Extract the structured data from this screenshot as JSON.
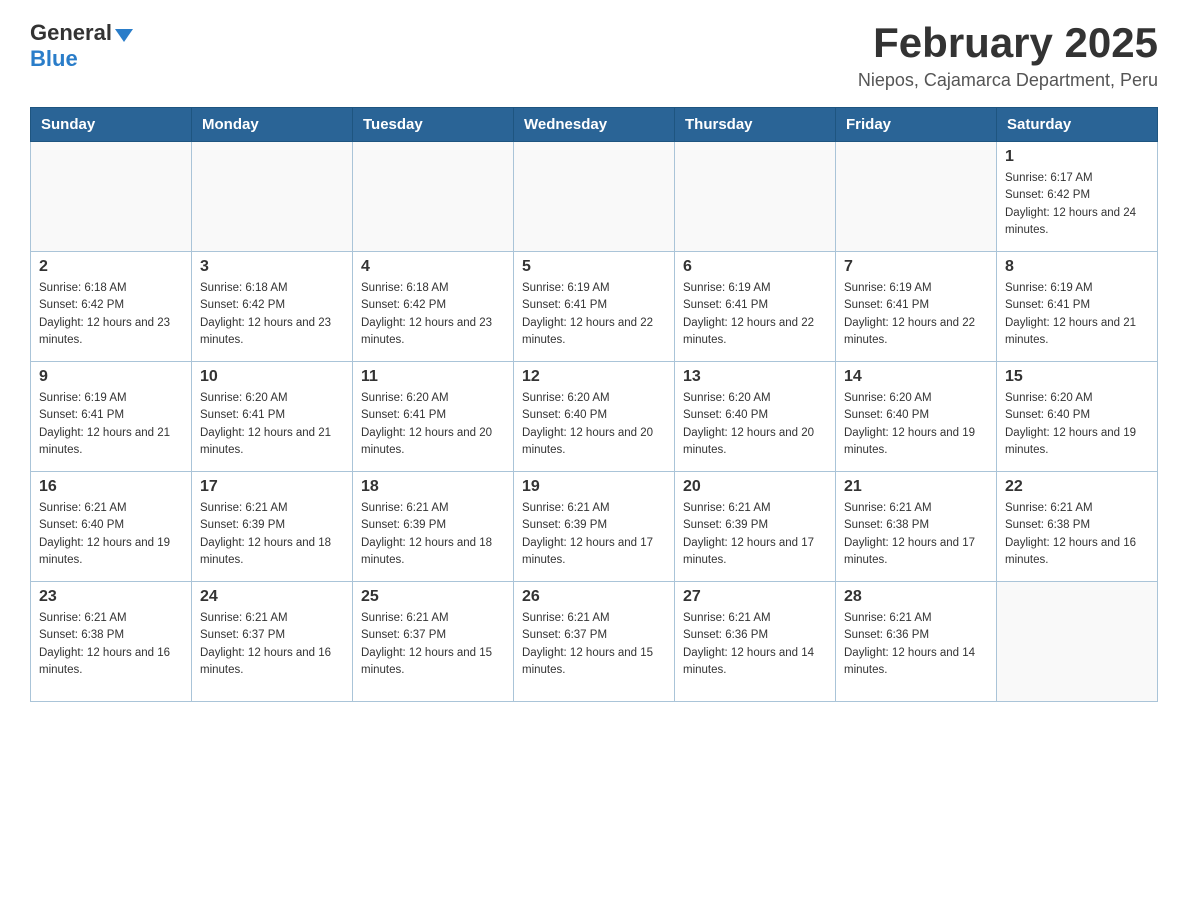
{
  "header": {
    "logo_general": "General",
    "logo_blue": "Blue",
    "month_title": "February 2025",
    "location": "Niepos, Cajamarca Department, Peru"
  },
  "weekdays": [
    "Sunday",
    "Monday",
    "Tuesday",
    "Wednesday",
    "Thursday",
    "Friday",
    "Saturday"
  ],
  "weeks": [
    [
      {
        "day": "",
        "sunrise": "",
        "sunset": "",
        "daylight": ""
      },
      {
        "day": "",
        "sunrise": "",
        "sunset": "",
        "daylight": ""
      },
      {
        "day": "",
        "sunrise": "",
        "sunset": "",
        "daylight": ""
      },
      {
        "day": "",
        "sunrise": "",
        "sunset": "",
        "daylight": ""
      },
      {
        "day": "",
        "sunrise": "",
        "sunset": "",
        "daylight": ""
      },
      {
        "day": "",
        "sunrise": "",
        "sunset": "",
        "daylight": ""
      },
      {
        "day": "1",
        "sunrise": "Sunrise: 6:17 AM",
        "sunset": "Sunset: 6:42 PM",
        "daylight": "Daylight: 12 hours and 24 minutes."
      }
    ],
    [
      {
        "day": "2",
        "sunrise": "Sunrise: 6:18 AM",
        "sunset": "Sunset: 6:42 PM",
        "daylight": "Daylight: 12 hours and 23 minutes."
      },
      {
        "day": "3",
        "sunrise": "Sunrise: 6:18 AM",
        "sunset": "Sunset: 6:42 PM",
        "daylight": "Daylight: 12 hours and 23 minutes."
      },
      {
        "day": "4",
        "sunrise": "Sunrise: 6:18 AM",
        "sunset": "Sunset: 6:42 PM",
        "daylight": "Daylight: 12 hours and 23 minutes."
      },
      {
        "day": "5",
        "sunrise": "Sunrise: 6:19 AM",
        "sunset": "Sunset: 6:41 PM",
        "daylight": "Daylight: 12 hours and 22 minutes."
      },
      {
        "day": "6",
        "sunrise": "Sunrise: 6:19 AM",
        "sunset": "Sunset: 6:41 PM",
        "daylight": "Daylight: 12 hours and 22 minutes."
      },
      {
        "day": "7",
        "sunrise": "Sunrise: 6:19 AM",
        "sunset": "Sunset: 6:41 PM",
        "daylight": "Daylight: 12 hours and 22 minutes."
      },
      {
        "day": "8",
        "sunrise": "Sunrise: 6:19 AM",
        "sunset": "Sunset: 6:41 PM",
        "daylight": "Daylight: 12 hours and 21 minutes."
      }
    ],
    [
      {
        "day": "9",
        "sunrise": "Sunrise: 6:19 AM",
        "sunset": "Sunset: 6:41 PM",
        "daylight": "Daylight: 12 hours and 21 minutes."
      },
      {
        "day": "10",
        "sunrise": "Sunrise: 6:20 AM",
        "sunset": "Sunset: 6:41 PM",
        "daylight": "Daylight: 12 hours and 21 minutes."
      },
      {
        "day": "11",
        "sunrise": "Sunrise: 6:20 AM",
        "sunset": "Sunset: 6:41 PM",
        "daylight": "Daylight: 12 hours and 20 minutes."
      },
      {
        "day": "12",
        "sunrise": "Sunrise: 6:20 AM",
        "sunset": "Sunset: 6:40 PM",
        "daylight": "Daylight: 12 hours and 20 minutes."
      },
      {
        "day": "13",
        "sunrise": "Sunrise: 6:20 AM",
        "sunset": "Sunset: 6:40 PM",
        "daylight": "Daylight: 12 hours and 20 minutes."
      },
      {
        "day": "14",
        "sunrise": "Sunrise: 6:20 AM",
        "sunset": "Sunset: 6:40 PM",
        "daylight": "Daylight: 12 hours and 19 minutes."
      },
      {
        "day": "15",
        "sunrise": "Sunrise: 6:20 AM",
        "sunset": "Sunset: 6:40 PM",
        "daylight": "Daylight: 12 hours and 19 minutes."
      }
    ],
    [
      {
        "day": "16",
        "sunrise": "Sunrise: 6:21 AM",
        "sunset": "Sunset: 6:40 PM",
        "daylight": "Daylight: 12 hours and 19 minutes."
      },
      {
        "day": "17",
        "sunrise": "Sunrise: 6:21 AM",
        "sunset": "Sunset: 6:39 PM",
        "daylight": "Daylight: 12 hours and 18 minutes."
      },
      {
        "day": "18",
        "sunrise": "Sunrise: 6:21 AM",
        "sunset": "Sunset: 6:39 PM",
        "daylight": "Daylight: 12 hours and 18 minutes."
      },
      {
        "day": "19",
        "sunrise": "Sunrise: 6:21 AM",
        "sunset": "Sunset: 6:39 PM",
        "daylight": "Daylight: 12 hours and 17 minutes."
      },
      {
        "day": "20",
        "sunrise": "Sunrise: 6:21 AM",
        "sunset": "Sunset: 6:39 PM",
        "daylight": "Daylight: 12 hours and 17 minutes."
      },
      {
        "day": "21",
        "sunrise": "Sunrise: 6:21 AM",
        "sunset": "Sunset: 6:38 PM",
        "daylight": "Daylight: 12 hours and 17 minutes."
      },
      {
        "day": "22",
        "sunrise": "Sunrise: 6:21 AM",
        "sunset": "Sunset: 6:38 PM",
        "daylight": "Daylight: 12 hours and 16 minutes."
      }
    ],
    [
      {
        "day": "23",
        "sunrise": "Sunrise: 6:21 AM",
        "sunset": "Sunset: 6:38 PM",
        "daylight": "Daylight: 12 hours and 16 minutes."
      },
      {
        "day": "24",
        "sunrise": "Sunrise: 6:21 AM",
        "sunset": "Sunset: 6:37 PM",
        "daylight": "Daylight: 12 hours and 16 minutes."
      },
      {
        "day": "25",
        "sunrise": "Sunrise: 6:21 AM",
        "sunset": "Sunset: 6:37 PM",
        "daylight": "Daylight: 12 hours and 15 minutes."
      },
      {
        "day": "26",
        "sunrise": "Sunrise: 6:21 AM",
        "sunset": "Sunset: 6:37 PM",
        "daylight": "Daylight: 12 hours and 15 minutes."
      },
      {
        "day": "27",
        "sunrise": "Sunrise: 6:21 AM",
        "sunset": "Sunset: 6:36 PM",
        "daylight": "Daylight: 12 hours and 14 minutes."
      },
      {
        "day": "28",
        "sunrise": "Sunrise: 6:21 AM",
        "sunset": "Sunset: 6:36 PM",
        "daylight": "Daylight: 12 hours and 14 minutes."
      },
      {
        "day": "",
        "sunrise": "",
        "sunset": "",
        "daylight": ""
      }
    ]
  ]
}
